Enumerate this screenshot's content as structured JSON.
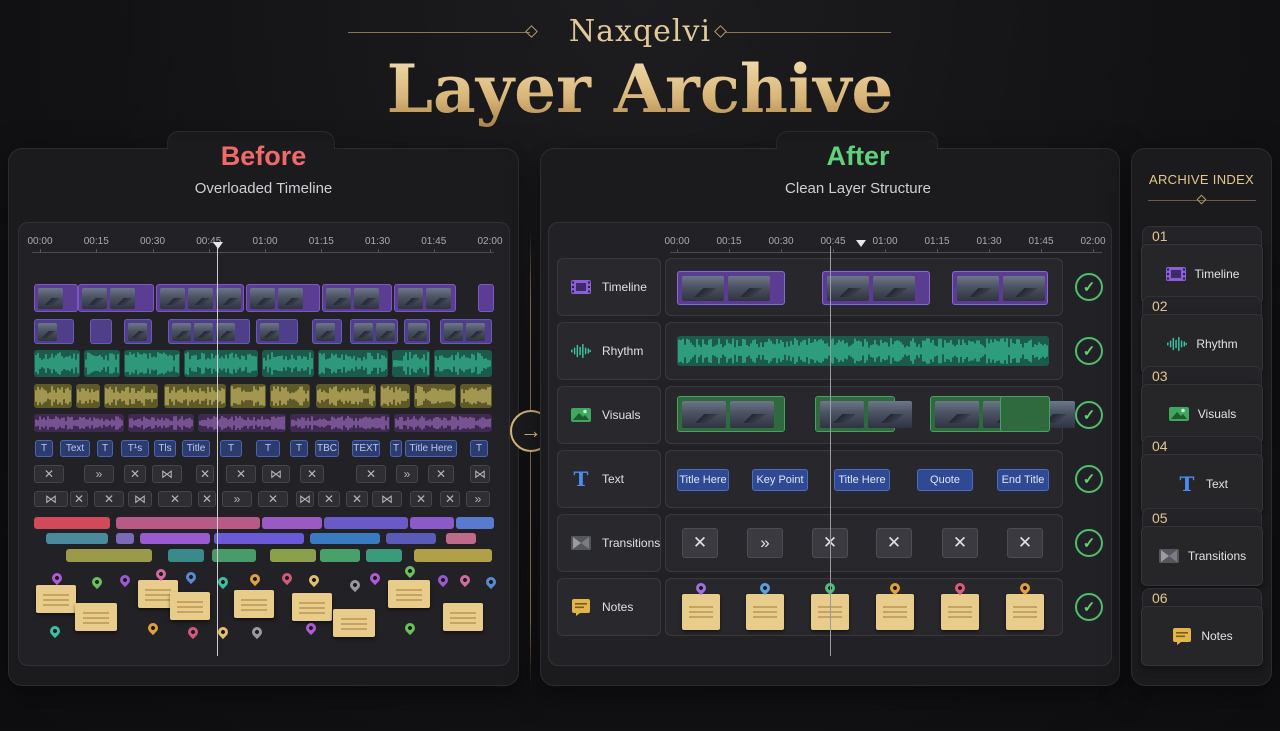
{
  "header": {
    "brand": "Naxqelvi",
    "title": "Layer Archive"
  },
  "colors": {
    "gold": "#e6c68e",
    "before": "#f06a6a",
    "after": "#5fd07c"
  },
  "before": {
    "title": "Before",
    "subtitle": "Overloaded Timeline",
    "ruler": [
      "00:00",
      "00:15",
      "00:30",
      "00:45",
      "01:00",
      "01:15",
      "01:30",
      "01:45",
      "02:00"
    ],
    "text_clips": [
      "T",
      "Text",
      "T",
      "T¹s",
      "Tls",
      "Title",
      "T",
      "T",
      "T",
      "TBC",
      "TEXT",
      "T",
      "Title Here",
      "T"
    ]
  },
  "after": {
    "title": "After",
    "subtitle": "Clean Layer Structure",
    "ruler": [
      "00:00",
      "00:15",
      "00:30",
      "00:45",
      "01:00",
      "01:15",
      "01:30",
      "01:45",
      "02:00"
    ],
    "rows": [
      {
        "label": "Timeline",
        "icon": "film-icon"
      },
      {
        "label": "Rhythm",
        "icon": "waveform-icon"
      },
      {
        "label": "Visuals",
        "icon": "image-icon"
      },
      {
        "label": "Text",
        "icon": "text-icon"
      },
      {
        "label": "Transitions",
        "icon": "transition-icon"
      },
      {
        "label": "Notes",
        "icon": "note-icon"
      }
    ],
    "text_clips": [
      "Title Here",
      "Key Point",
      "Title Here",
      "Quote",
      "End Title"
    ]
  },
  "index": {
    "title": "ARCHIVE INDEX",
    "items": [
      {
        "num": "01",
        "label": "Timeline",
        "icon": "film-icon"
      },
      {
        "num": "02",
        "label": "Rhythm",
        "icon": "waveform-icon"
      },
      {
        "num": "03",
        "label": "Visuals",
        "icon": "image-icon"
      },
      {
        "num": "04",
        "label": "Text",
        "icon": "text-icon"
      },
      {
        "num": "05",
        "label": "Transitions",
        "icon": "transition-icon"
      },
      {
        "num": "06",
        "label": "Notes",
        "icon": "note-icon"
      }
    ]
  }
}
